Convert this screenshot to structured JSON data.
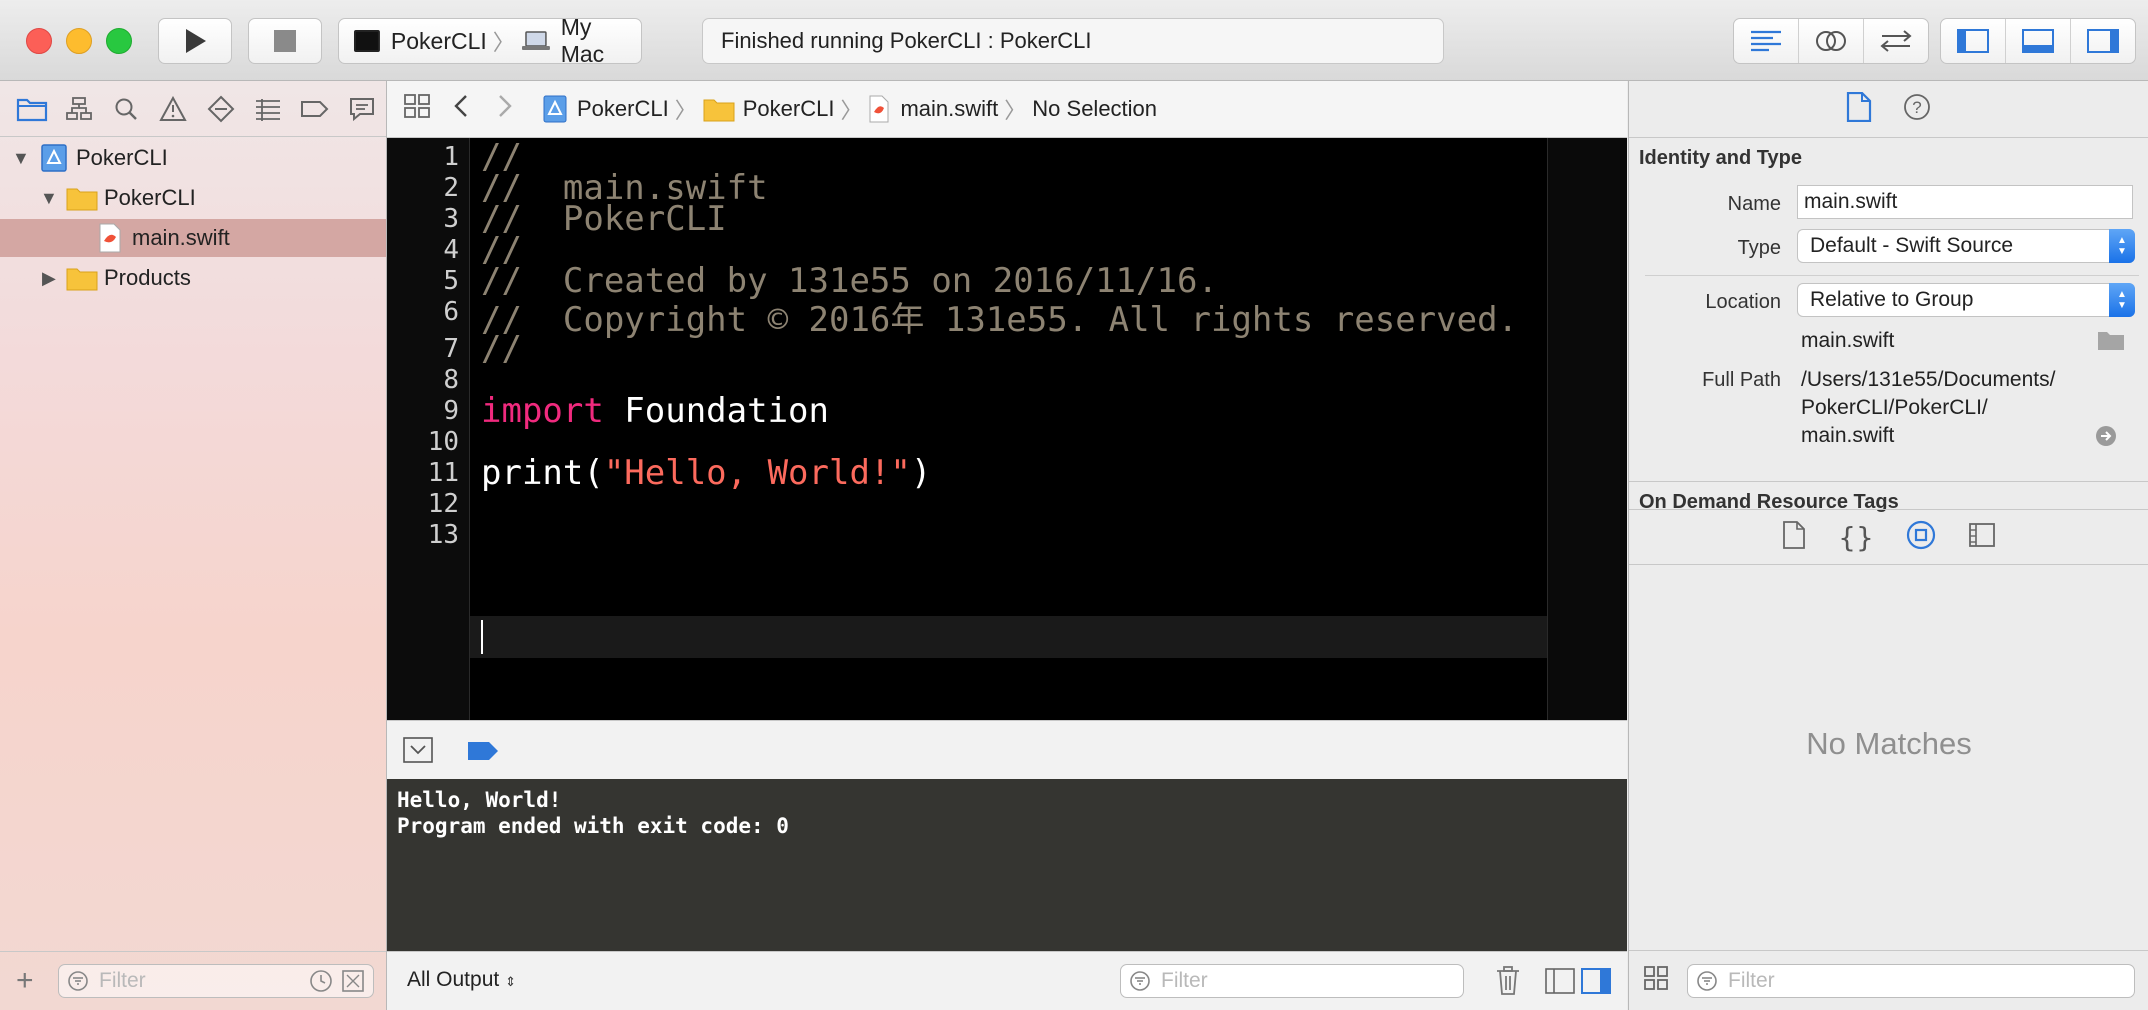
{
  "toolbar": {
    "scheme_target": "PokerCLI",
    "scheme_device": "My Mac",
    "activity_status": "Finished running PokerCLI : PokerCLI"
  },
  "navigator": {
    "tree": [
      {
        "label": "PokerCLI",
        "kind": "project",
        "expanded": true
      },
      {
        "label": "PokerCLI",
        "kind": "group",
        "expanded": true
      },
      {
        "label": "main.swift",
        "kind": "swift-file",
        "selected": true
      },
      {
        "label": "Products",
        "kind": "group",
        "expanded": false
      }
    ],
    "filter_placeholder": "Filter"
  },
  "jump_bar": {
    "items": [
      "PokerCLI",
      "PokerCLI",
      "main.swift",
      "No Selection"
    ]
  },
  "editor": {
    "line_numbers": [
      "1",
      "2",
      "3",
      "4",
      "5",
      "6",
      "7",
      "8",
      "9",
      "10",
      "11",
      "12",
      "13"
    ],
    "lines": {
      "l1": "//",
      "l2": "//  main.swift",
      "l3": "//  PokerCLI",
      "l4": "//",
      "l5": "//  Created by 131e55 on 2016/11/16.",
      "l6": "//  Copyright © 2016年 131e55. All rights reserved.",
      "l7": "//",
      "l9_keyword": "import",
      "l9_rest": " Foundation",
      "l11_fn": "print(",
      "l11_str": "\"Hello, World!\"",
      "l11_end": ")"
    },
    "current_line": 12
  },
  "console": {
    "output_line1": "Hello, World!",
    "output_line2": "Program ended with exit code: 0",
    "output_mode": "All Output",
    "filter_placeholder": "Filter"
  },
  "inspector": {
    "section_identity": "Identity and Type",
    "name_label": "Name",
    "name_value": "main.swift",
    "type_label": "Type",
    "type_value": "Default - Swift Source",
    "location_label": "Location",
    "location_value": "Relative to Group",
    "location_file": "main.swift",
    "fullpath_label": "Full Path",
    "fullpath_line1": "/Users/131e55/Documents/",
    "fullpath_line2": "PokerCLI/PokerCLI/",
    "fullpath_line3": "main.swift",
    "section_ondemand": "On Demand Resource Tags",
    "library_empty": "No Matches",
    "filter_placeholder": "Filter"
  },
  "colors": {
    "comment": "#8d8372",
    "keyword": "#f02a7e",
    "string": "#fc6a5d",
    "accent": "#1a72e8"
  }
}
